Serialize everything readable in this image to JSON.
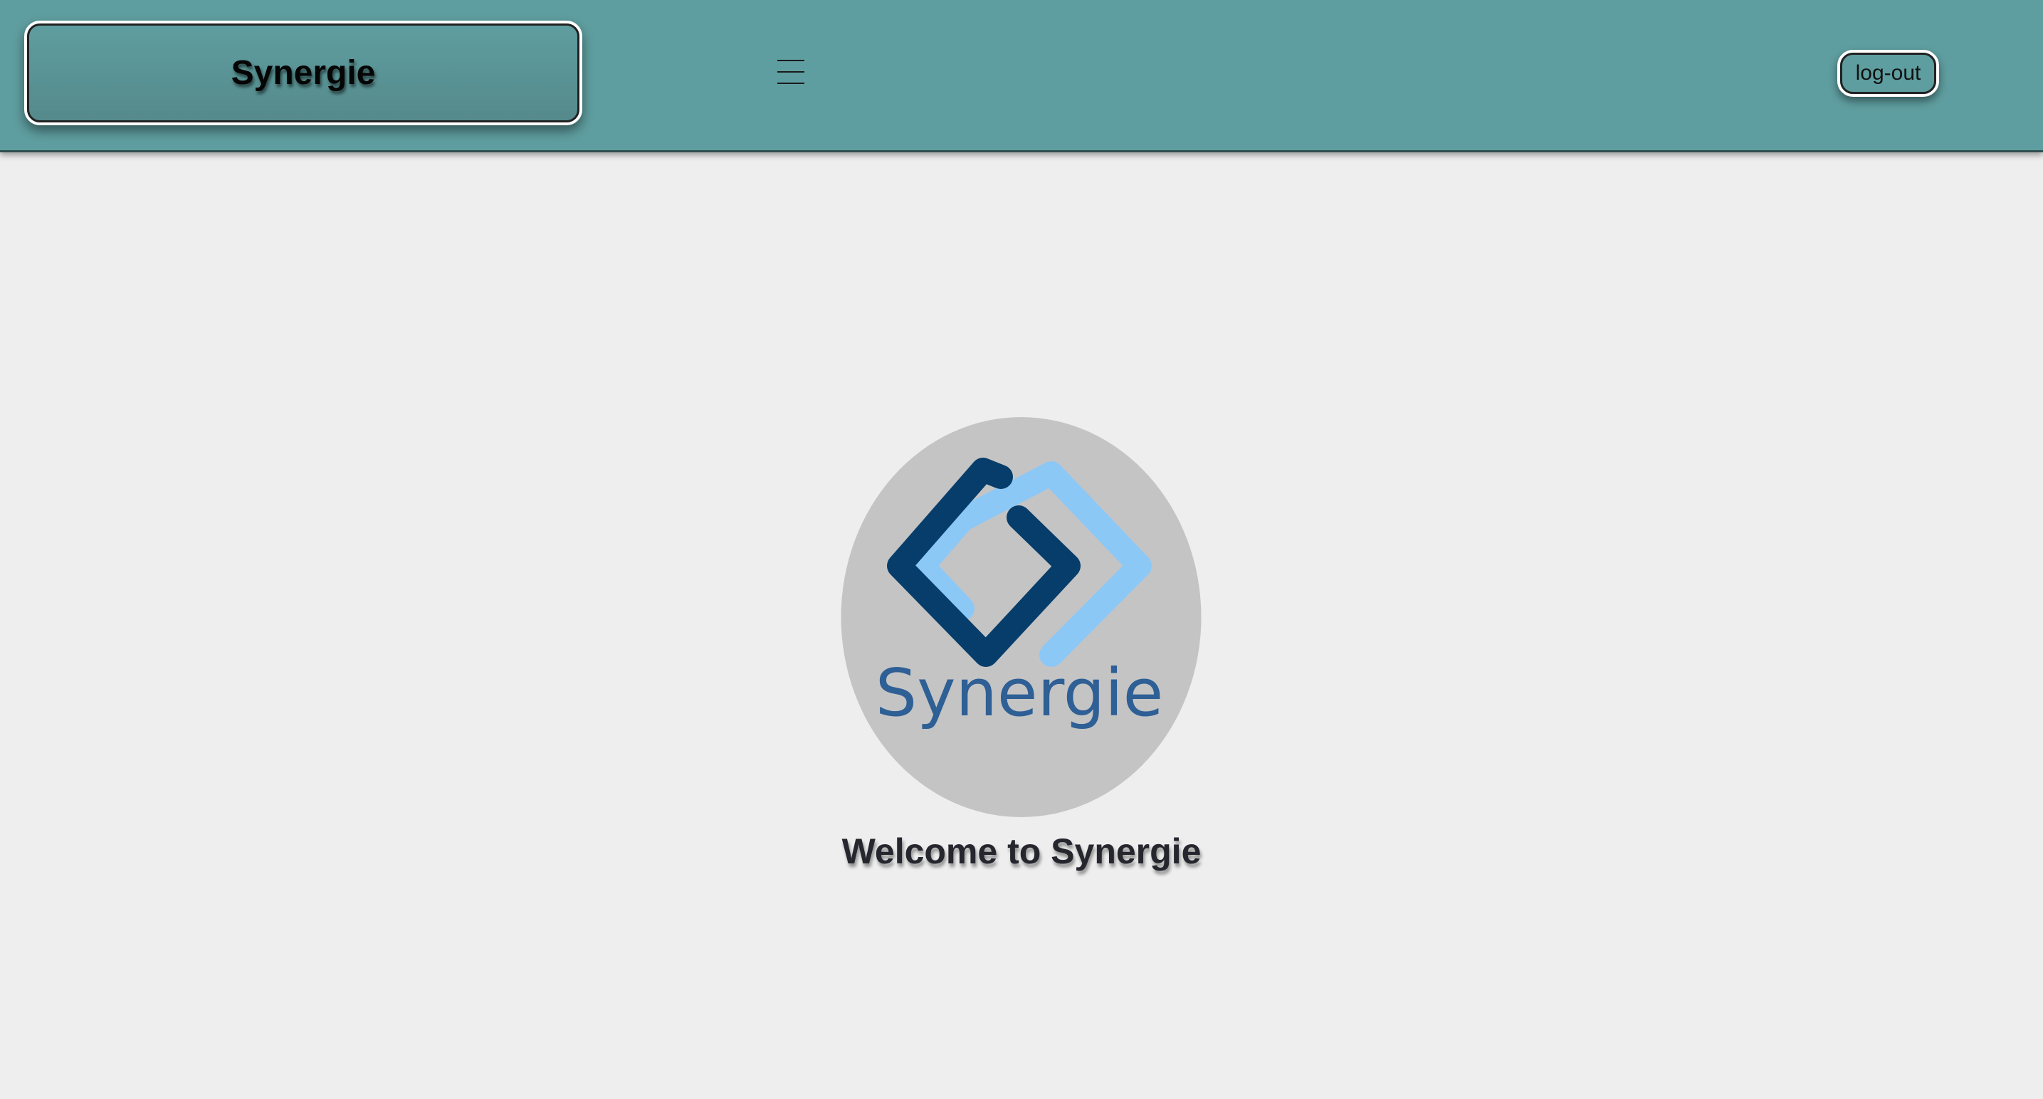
{
  "header": {
    "brand_title": "Synergie",
    "menu_icon": "hamburger-menu-icon",
    "logout_label": "log-out",
    "bar_color": "#5f9ea0"
  },
  "main": {
    "logo": {
      "icon": "synergie-interlocking-diamonds-logo",
      "wordmark": "Synergie",
      "dark_color": "#063d6b",
      "light_color": "#8cc8f6",
      "wordmark_color": "#2e5f95",
      "circle_color": "#c4c4c4"
    },
    "welcome_text": "Welcome to Synergie"
  }
}
